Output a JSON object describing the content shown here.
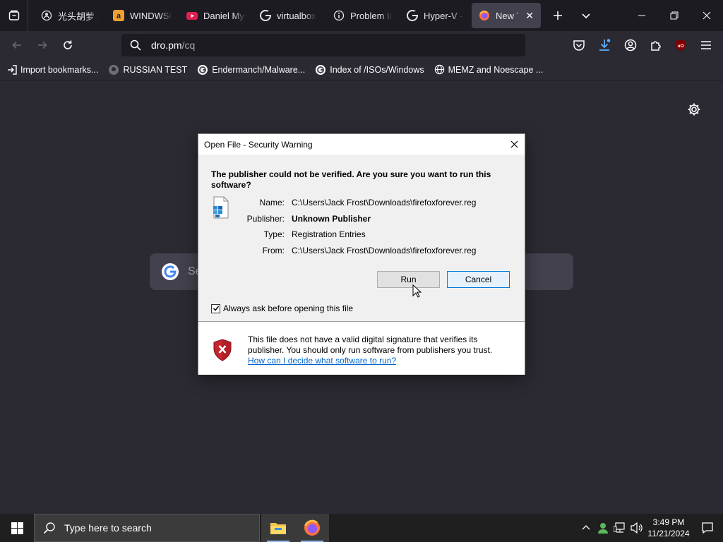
{
  "browser": {
    "tabs": [
      {
        "label": "光头胡萝卜",
        "icon": "github-icon"
      },
      {
        "label": "WINDWSC",
        "icon": "amazon-icon"
      },
      {
        "label": "Daniel Myst",
        "icon": "youtube-icon"
      },
      {
        "label": "virtualbox",
        "icon": "google-icon"
      },
      {
        "label": "Problem Id",
        "icon": "info-icon"
      },
      {
        "label": "Hyper-V - ",
        "icon": "google-icon"
      },
      {
        "label": "New Tab",
        "icon": "firefox-icon",
        "active": true
      }
    ],
    "url": {
      "host": "dro.pm",
      "path": "/cq"
    },
    "bookmarks": [
      {
        "label": "Import bookmarks...",
        "icon": "import-icon"
      },
      {
        "label": "RUSSIAN TEST",
        "icon": "github-icon"
      },
      {
        "label": "Endermanch/Malware...",
        "icon": "google-icon"
      },
      {
        "label": "Index of /ISOs/Windows",
        "icon": "google-icon"
      },
      {
        "label": "MEMZ and Noescape ...",
        "icon": "globe-icon"
      }
    ],
    "newtab": {
      "search_placeholder": "Se"
    }
  },
  "dialog": {
    "title": "Open File - Security Warning",
    "headline": "The publisher could not be verified.  Are you sure you want to run this software?",
    "fields": [
      {
        "key": "Name:",
        "value": "C:\\Users\\Jack Frost\\Downloads\\firefoxforever.reg",
        "bold": false
      },
      {
        "key": "Publisher:",
        "value": "Unknown Publisher",
        "bold": true
      },
      {
        "key": "Type:",
        "value": "Registration Entries",
        "bold": false
      },
      {
        "key": "From:",
        "value": "C:\\Users\\Jack Frost\\Downloads\\firefoxforever.reg",
        "bold": false
      }
    ],
    "run_label": "Run",
    "cancel_label": "Cancel",
    "checkbox_label": "Always ask before opening this file",
    "checkbox_checked": true,
    "warning_text": "This file does not have a valid digital signature that verifies its publisher.  You should only run software from publishers you trust.",
    "warning_link": "How can I decide what software to run?"
  },
  "taskbar": {
    "search_placeholder": "Type here to search",
    "time": "3:49 PM",
    "date": "11/21/2024"
  },
  "colors": {
    "accent": "#0078d7",
    "link": "#0066cc",
    "browser_bg": "#2b2a33",
    "tabstrip_bg": "#1c1b22"
  }
}
